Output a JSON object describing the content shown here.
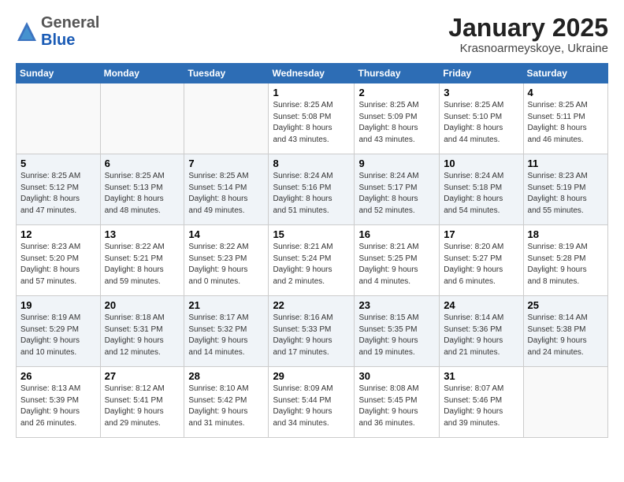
{
  "logo": {
    "general": "General",
    "blue": "Blue"
  },
  "title": "January 2025",
  "subtitle": "Krasnoarmeyskoye, Ukraine",
  "days_header": [
    "Sunday",
    "Monday",
    "Tuesday",
    "Wednesday",
    "Thursday",
    "Friday",
    "Saturday"
  ],
  "weeks": [
    [
      {
        "day": "",
        "info": ""
      },
      {
        "day": "",
        "info": ""
      },
      {
        "day": "",
        "info": ""
      },
      {
        "day": "1",
        "info": "Sunrise: 8:25 AM\nSunset: 5:08 PM\nDaylight: 8 hours\nand 43 minutes."
      },
      {
        "day": "2",
        "info": "Sunrise: 8:25 AM\nSunset: 5:09 PM\nDaylight: 8 hours\nand 43 minutes."
      },
      {
        "day": "3",
        "info": "Sunrise: 8:25 AM\nSunset: 5:10 PM\nDaylight: 8 hours\nand 44 minutes."
      },
      {
        "day": "4",
        "info": "Sunrise: 8:25 AM\nSunset: 5:11 PM\nDaylight: 8 hours\nand 46 minutes."
      }
    ],
    [
      {
        "day": "5",
        "info": "Sunrise: 8:25 AM\nSunset: 5:12 PM\nDaylight: 8 hours\nand 47 minutes."
      },
      {
        "day": "6",
        "info": "Sunrise: 8:25 AM\nSunset: 5:13 PM\nDaylight: 8 hours\nand 48 minutes."
      },
      {
        "day": "7",
        "info": "Sunrise: 8:25 AM\nSunset: 5:14 PM\nDaylight: 8 hours\nand 49 minutes."
      },
      {
        "day": "8",
        "info": "Sunrise: 8:24 AM\nSunset: 5:16 PM\nDaylight: 8 hours\nand 51 minutes."
      },
      {
        "day": "9",
        "info": "Sunrise: 8:24 AM\nSunset: 5:17 PM\nDaylight: 8 hours\nand 52 minutes."
      },
      {
        "day": "10",
        "info": "Sunrise: 8:24 AM\nSunset: 5:18 PM\nDaylight: 8 hours\nand 54 minutes."
      },
      {
        "day": "11",
        "info": "Sunrise: 8:23 AM\nSunset: 5:19 PM\nDaylight: 8 hours\nand 55 minutes."
      }
    ],
    [
      {
        "day": "12",
        "info": "Sunrise: 8:23 AM\nSunset: 5:20 PM\nDaylight: 8 hours\nand 57 minutes."
      },
      {
        "day": "13",
        "info": "Sunrise: 8:22 AM\nSunset: 5:21 PM\nDaylight: 8 hours\nand 59 minutes."
      },
      {
        "day": "14",
        "info": "Sunrise: 8:22 AM\nSunset: 5:23 PM\nDaylight: 9 hours\nand 0 minutes."
      },
      {
        "day": "15",
        "info": "Sunrise: 8:21 AM\nSunset: 5:24 PM\nDaylight: 9 hours\nand 2 minutes."
      },
      {
        "day": "16",
        "info": "Sunrise: 8:21 AM\nSunset: 5:25 PM\nDaylight: 9 hours\nand 4 minutes."
      },
      {
        "day": "17",
        "info": "Sunrise: 8:20 AM\nSunset: 5:27 PM\nDaylight: 9 hours\nand 6 minutes."
      },
      {
        "day": "18",
        "info": "Sunrise: 8:19 AM\nSunset: 5:28 PM\nDaylight: 9 hours\nand 8 minutes."
      }
    ],
    [
      {
        "day": "19",
        "info": "Sunrise: 8:19 AM\nSunset: 5:29 PM\nDaylight: 9 hours\nand 10 minutes."
      },
      {
        "day": "20",
        "info": "Sunrise: 8:18 AM\nSunset: 5:31 PM\nDaylight: 9 hours\nand 12 minutes."
      },
      {
        "day": "21",
        "info": "Sunrise: 8:17 AM\nSunset: 5:32 PM\nDaylight: 9 hours\nand 14 minutes."
      },
      {
        "day": "22",
        "info": "Sunrise: 8:16 AM\nSunset: 5:33 PM\nDaylight: 9 hours\nand 17 minutes."
      },
      {
        "day": "23",
        "info": "Sunrise: 8:15 AM\nSunset: 5:35 PM\nDaylight: 9 hours\nand 19 minutes."
      },
      {
        "day": "24",
        "info": "Sunrise: 8:14 AM\nSunset: 5:36 PM\nDaylight: 9 hours\nand 21 minutes."
      },
      {
        "day": "25",
        "info": "Sunrise: 8:14 AM\nSunset: 5:38 PM\nDaylight: 9 hours\nand 24 minutes."
      }
    ],
    [
      {
        "day": "26",
        "info": "Sunrise: 8:13 AM\nSunset: 5:39 PM\nDaylight: 9 hours\nand 26 minutes."
      },
      {
        "day": "27",
        "info": "Sunrise: 8:12 AM\nSunset: 5:41 PM\nDaylight: 9 hours\nand 29 minutes."
      },
      {
        "day": "28",
        "info": "Sunrise: 8:10 AM\nSunset: 5:42 PM\nDaylight: 9 hours\nand 31 minutes."
      },
      {
        "day": "29",
        "info": "Sunrise: 8:09 AM\nSunset: 5:44 PM\nDaylight: 9 hours\nand 34 minutes."
      },
      {
        "day": "30",
        "info": "Sunrise: 8:08 AM\nSunset: 5:45 PM\nDaylight: 9 hours\nand 36 minutes."
      },
      {
        "day": "31",
        "info": "Sunrise: 8:07 AM\nSunset: 5:46 PM\nDaylight: 9 hours\nand 39 minutes."
      },
      {
        "day": "",
        "info": ""
      }
    ]
  ]
}
